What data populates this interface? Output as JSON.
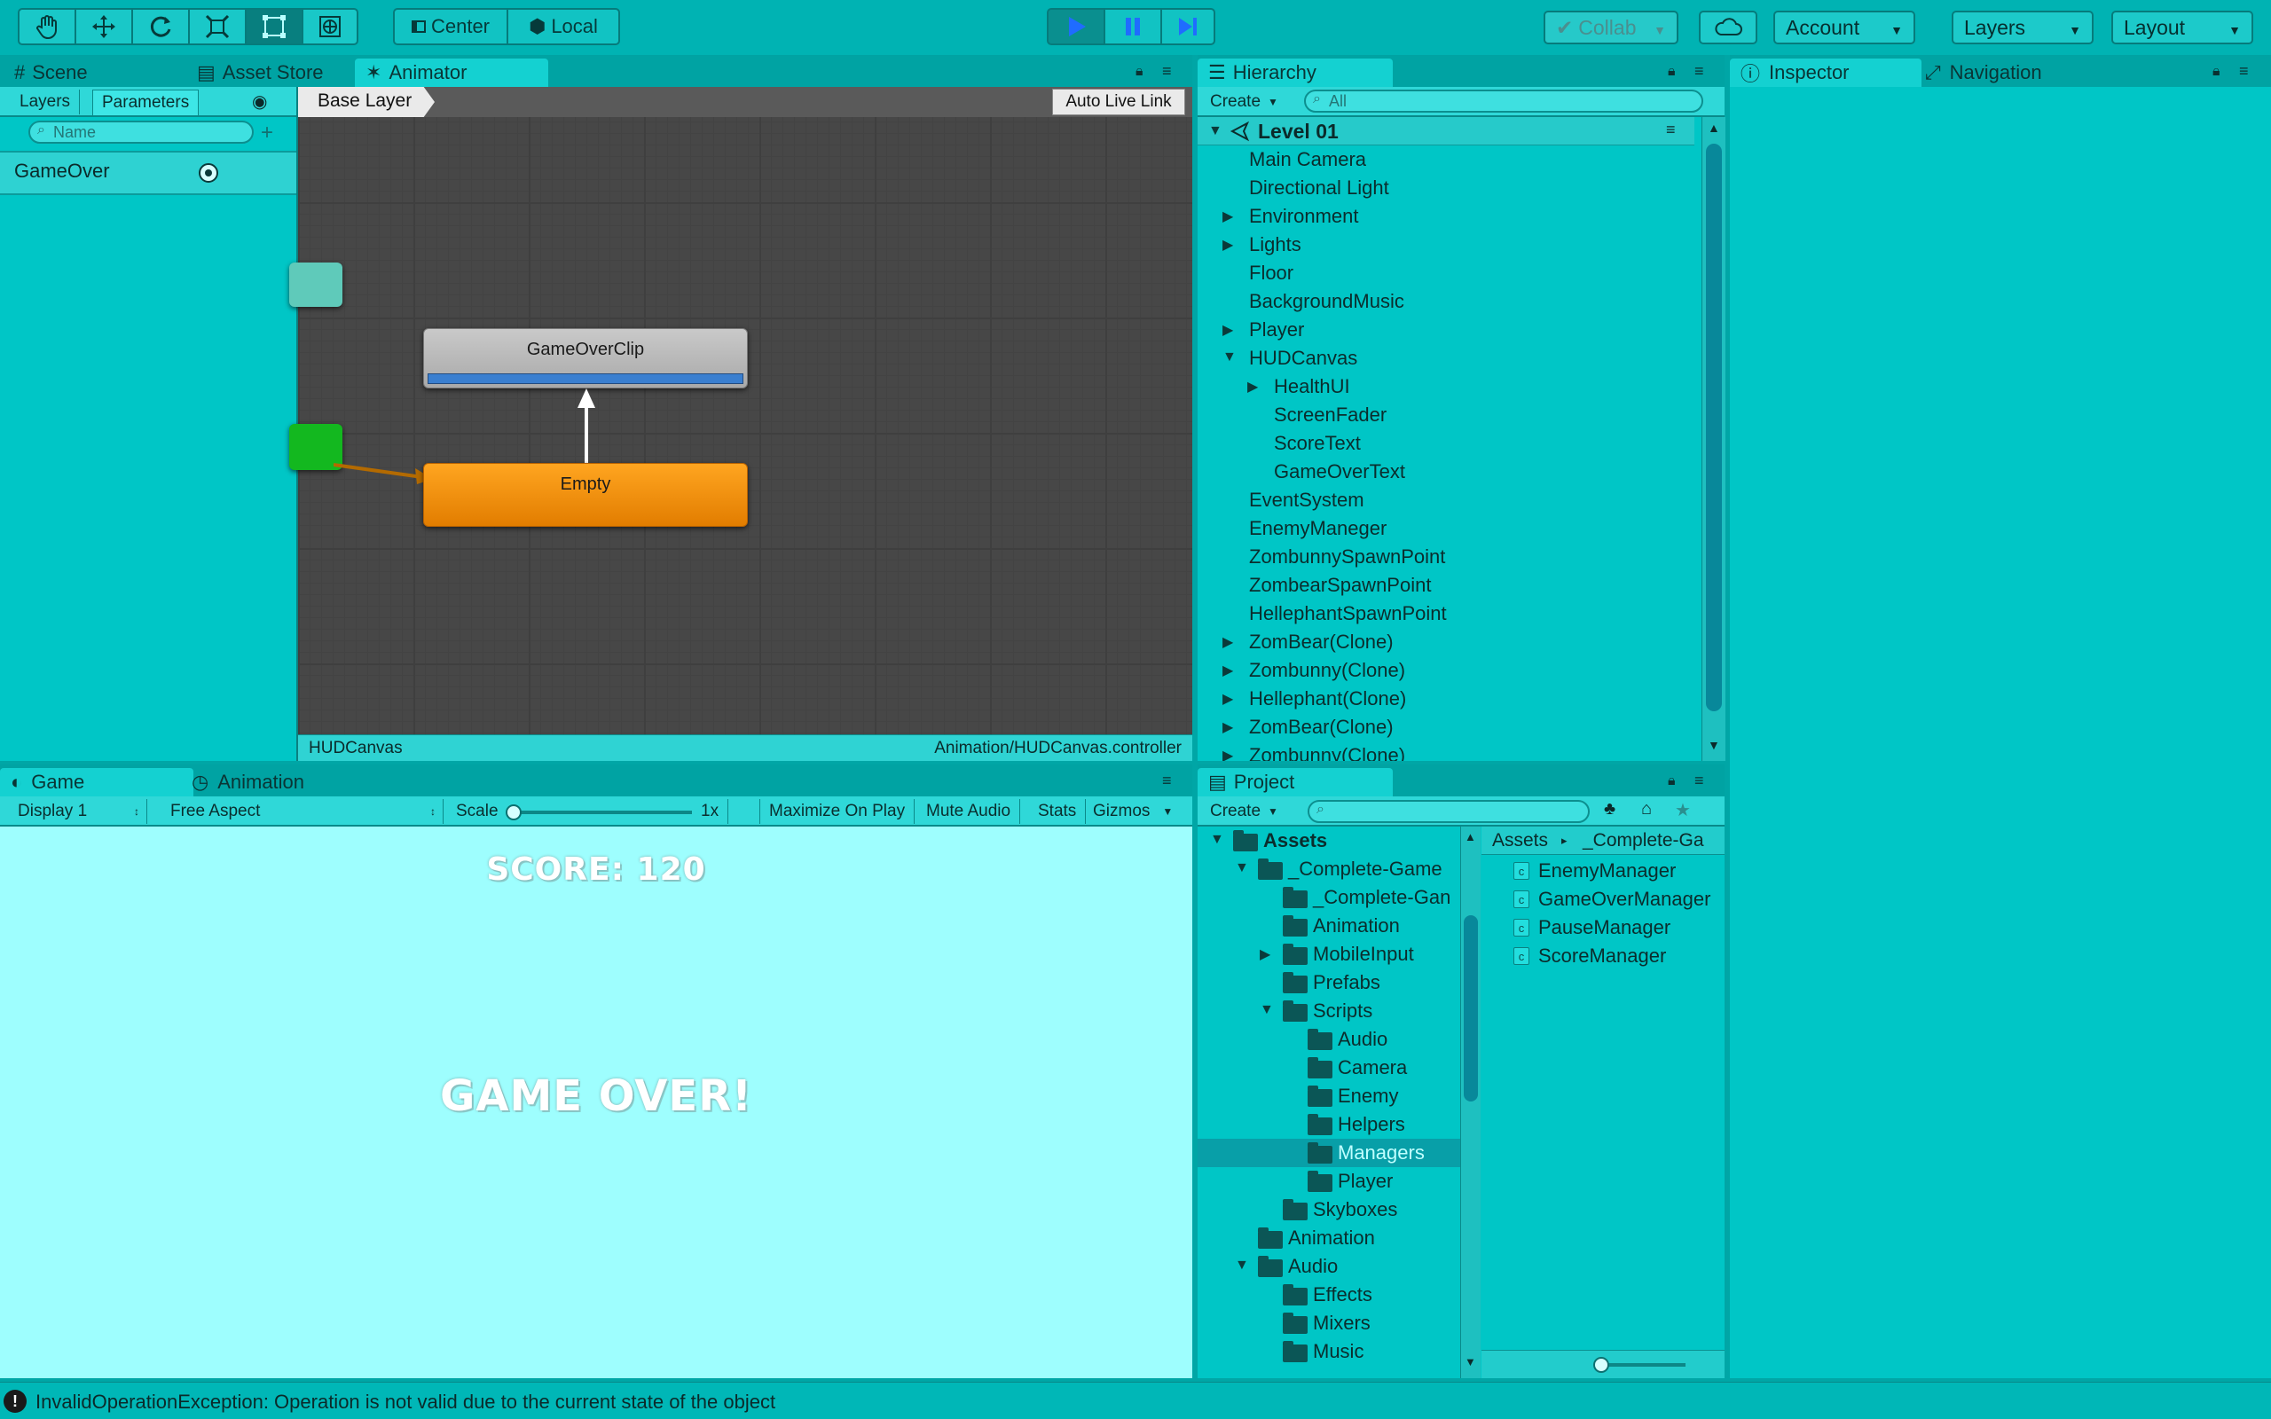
{
  "toolbar": {
    "tools": [
      "hand-tool",
      "move-tool",
      "rotate-tool",
      "scale-tool",
      "rect-tool",
      "transform-tool"
    ],
    "pivot_label": "Center",
    "space_label": "Local",
    "collab_label": "Collab",
    "account_label": "Account",
    "layers_label": "Layers",
    "layout_label": "Layout"
  },
  "animator_panel": {
    "tabs": [
      "Scene",
      "Asset Store",
      "Animator"
    ],
    "sub_tabs": [
      "Layers",
      "Parameters"
    ],
    "search_placeholder": "Name",
    "parameter": "GameOver",
    "breadcrumb": "Base Layer",
    "auto_live_link": "Auto Live Link",
    "states": {
      "clip": "GameOverClip",
      "empty": "Empty"
    },
    "footer_left": "HUDCanvas",
    "footer_right": "Animation/HUDCanvas.controller"
  },
  "hierarchy": {
    "tab": "Hierarchy",
    "create_label": "Create",
    "search_placeholder": "All",
    "scene": "Level 01",
    "items": [
      {
        "label": "Main Camera",
        "depth": 0,
        "expander": "none"
      },
      {
        "label": "Directional Light",
        "depth": 0,
        "expander": "none"
      },
      {
        "label": "Environment",
        "depth": 0,
        "expander": "collapsed"
      },
      {
        "label": "Lights",
        "depth": 0,
        "expander": "collapsed"
      },
      {
        "label": "Floor",
        "depth": 0,
        "expander": "none"
      },
      {
        "label": "BackgroundMusic",
        "depth": 0,
        "expander": "none"
      },
      {
        "label": "Player",
        "depth": 0,
        "expander": "collapsed"
      },
      {
        "label": "HUDCanvas",
        "depth": 0,
        "expander": "expanded"
      },
      {
        "label": "HealthUI",
        "depth": 1,
        "expander": "collapsed"
      },
      {
        "label": "ScreenFader",
        "depth": 1,
        "expander": "none"
      },
      {
        "label": "ScoreText",
        "depth": 1,
        "expander": "none"
      },
      {
        "label": "GameOverText",
        "depth": 1,
        "expander": "none"
      },
      {
        "label": "EventSystem",
        "depth": 0,
        "expander": "none"
      },
      {
        "label": "EnemyManeger",
        "depth": 0,
        "expander": "none"
      },
      {
        "label": "ZombunnySpawnPoint",
        "depth": 0,
        "expander": "none"
      },
      {
        "label": "ZombearSpawnPoint",
        "depth": 0,
        "expander": "none"
      },
      {
        "label": "HellephantSpawnPoint",
        "depth": 0,
        "expander": "none"
      },
      {
        "label": "ZomBear(Clone)",
        "depth": 0,
        "expander": "collapsed"
      },
      {
        "label": "Zombunny(Clone)",
        "depth": 0,
        "expander": "collapsed"
      },
      {
        "label": "Hellephant(Clone)",
        "depth": 0,
        "expander": "collapsed"
      },
      {
        "label": "ZomBear(Clone)",
        "depth": 0,
        "expander": "collapsed"
      },
      {
        "label": "Zombunny(Clone)",
        "depth": 0,
        "expander": "collapsed"
      }
    ]
  },
  "inspector": {
    "tabs": [
      "Inspector",
      "Navigation"
    ]
  },
  "game_panel": {
    "tabs": [
      "Game",
      "Animation"
    ],
    "display": "Display 1",
    "aspect": "Free Aspect",
    "scale_label": "Scale",
    "scale_value": "1x",
    "buttons": [
      "Maximize On Play",
      "Mute Audio",
      "Stats",
      "Gizmos"
    ],
    "score_text": "SCORE: 120",
    "game_over_text": "GAME OVER!"
  },
  "project": {
    "tab": "Project",
    "create_label": "Create",
    "tree": [
      {
        "label": "Assets",
        "depth": 0,
        "expander": "expanded",
        "bold": true
      },
      {
        "label": "_Complete-Game",
        "depth": 1,
        "expander": "expanded"
      },
      {
        "label": "_Complete-Gan",
        "depth": 2,
        "expander": "none"
      },
      {
        "label": "Animation",
        "depth": 2,
        "expander": "none"
      },
      {
        "label": "MobileInput",
        "depth": 2,
        "expander": "collapsed"
      },
      {
        "label": "Prefabs",
        "depth": 2,
        "expander": "none"
      },
      {
        "label": "Scripts",
        "depth": 2,
        "expander": "expanded"
      },
      {
        "label": "Audio",
        "depth": 3,
        "expander": "none"
      },
      {
        "label": "Camera",
        "depth": 3,
        "expander": "none"
      },
      {
        "label": "Enemy",
        "depth": 3,
        "expander": "none"
      },
      {
        "label": "Helpers",
        "depth": 3,
        "expander": "none"
      },
      {
        "label": "Managers",
        "depth": 3,
        "expander": "none",
        "selected": true
      },
      {
        "label": "Player",
        "depth": 3,
        "expander": "none"
      },
      {
        "label": "Skyboxes",
        "depth": 2,
        "expander": "none"
      },
      {
        "label": "Animation",
        "depth": 1,
        "expander": "none"
      },
      {
        "label": "Audio",
        "depth": 1,
        "expander": "expanded"
      },
      {
        "label": "Effects",
        "depth": 2,
        "expander": "none"
      },
      {
        "label": "Mixers",
        "depth": 2,
        "expander": "none"
      },
      {
        "label": "Music",
        "depth": 2,
        "expander": "none"
      }
    ],
    "breadcrumb": [
      "Assets",
      "_Complete-Ga"
    ],
    "files": [
      "EnemyManager",
      "GameOverManager",
      "PauseManager",
      "ScoreManager"
    ]
  },
  "status_bar": {
    "message": "InvalidOperationException: Operation is not valid due to the current state of the object"
  },
  "colors": {
    "accent": "#00c6c6",
    "play_active": "#0a8f8f",
    "state_orange": "#f08c00",
    "state_grey": "#b0b0b0",
    "selection": "#089fa8"
  }
}
